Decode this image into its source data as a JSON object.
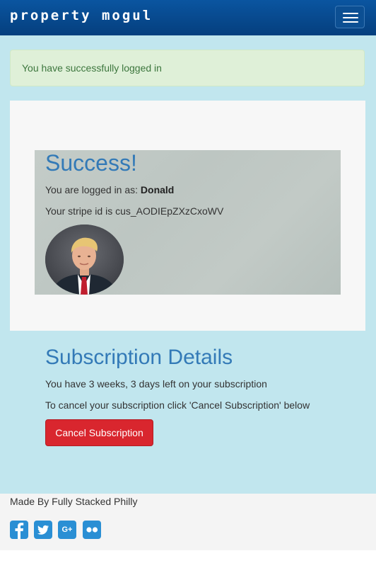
{
  "navbar": {
    "brand": "property mogul",
    "menu_icon": "hamburger-menu-icon"
  },
  "alert": {
    "message": "You have successfully logged in",
    "color": "#3c763d"
  },
  "profile": {
    "title": "Success!",
    "logged_in_prefix": "You are logged in as:",
    "username": "Donald",
    "stripe_prefix": "Your stripe id is",
    "stripe_id": "cus_AODIEpZXzCxoWV"
  },
  "subscription": {
    "title": "Subscription Details",
    "time_left": "You have 3 weeks, 3 days left on your subscription",
    "cancel_instruction": "To cancel your subscription click 'Cancel Subscription' below",
    "cancel_button": "Cancel Subscription"
  },
  "footer": {
    "made_by": "Made By Fully Stacked Philly",
    "social": {
      "facebook": "f",
      "googleplus": "G+"
    }
  },
  "colors": {
    "navbar": "#053f7e",
    "content_bg": "#c1e6ee",
    "accent": "#337ab7",
    "danger": "#d9262e",
    "social": "#2a8fd4"
  }
}
